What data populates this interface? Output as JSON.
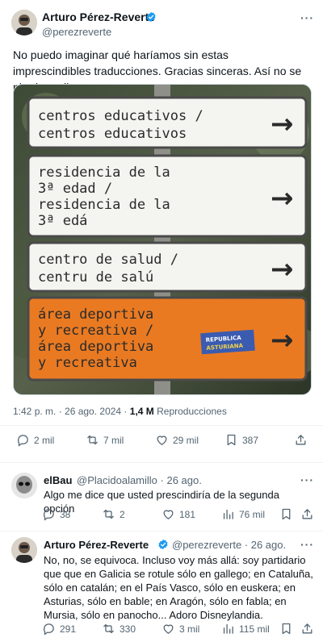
{
  "tweet": {
    "author_name": "Arturo Pérez-Reverte",
    "author_handle": "@perezreverte",
    "more_label": "···",
    "text": "No puedo imaginar qué haríamos sin estas imprescindibles traducciones. Gracias sinceras. Así no se pierde nadie",
    "signs": [
      {
        "line1": "centros educativos /",
        "line2": "centros educativos",
        "color": "#ffffff"
      },
      {
        "line1": "residencia de la",
        "line2": "3ª edad /",
        "line3": "residencia de la",
        "line4": "3ª edá",
        "color": "#ffffff"
      },
      {
        "line1": "centro de salud /",
        "line2": "centru de salú",
        "color": "#ffffff"
      },
      {
        "line1": "área deportiva",
        "line2": "y recreativa /",
        "line3": "área deportiva",
        "line4": "y recreativa",
        "color": "#e97a22"
      }
    ],
    "sticker_line1": "REPUBLICA",
    "sticker_line2": "ASTURIANA",
    "arrow": "→",
    "time": "1:42 p. m. · 26 ago. 2024 ·",
    "views_count": "1,4 M",
    "views_label": "Reproducciones",
    "stats": {
      "replies": "2 mil",
      "retweets": "7 mil",
      "likes": "29 mil",
      "bookmarks": "387"
    }
  },
  "replies": [
    {
      "name": "elBau",
      "handle_date": "@Placidoalamillo · 26 ago.",
      "text": "Algo me dice que usted prescindiría de la segunda opción",
      "stats": {
        "replies": "38",
        "retweets": "2",
        "likes": "181",
        "views": "76 mil"
      }
    },
    {
      "name": "Arturo Pérez-Reverte",
      "handle_date": "@perezreverte · 26 ago.",
      "text": "No, no, se equivoca. Incluso voy más allá: soy partidario que que en Galicia se rotule sólo en gallego; en Cataluña, sólo en catalán; en el País Vasco, sólo en euskera; en Asturias, sólo en bable; en Aragón, sólo en fabla; en Mursia, sólo en panocho... Adoro Disneylandia.",
      "stats": {
        "replies": "291",
        "retweets": "330",
        "likes": "3 mil",
        "views": "115 mil"
      }
    }
  ],
  "colors": {
    "verified": "#1d9bf0",
    "secondary": "#536471",
    "sign_orange": "#e97a22",
    "sign_border": "#4a4a4a"
  }
}
